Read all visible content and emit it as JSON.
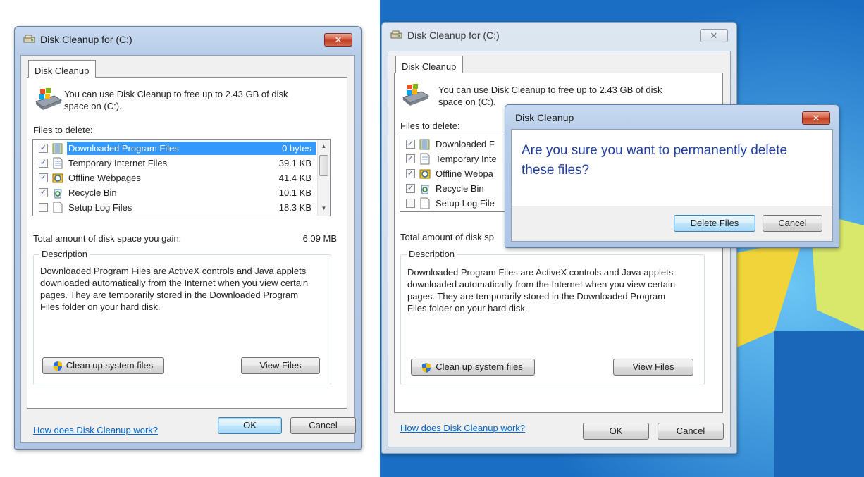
{
  "windows": [
    {
      "title": "Disk Cleanup for  (C:)",
      "tab": "Disk Cleanup",
      "intro": "You can use Disk Cleanup to free up to 2.43 GB of disk space on  (C:).",
      "intro_line1": "You can use Disk Cleanup to free up to 2.43 GB of disk",
      "intro_line2": "space on  (C:).",
      "files_label": "Files to delete:",
      "files": [
        {
          "label": "Downloaded Program Files",
          "size": "0 bytes",
          "checked": true,
          "selected": true,
          "icon": "folder-icon"
        },
        {
          "label": "Temporary Internet Files",
          "size": "39.1 KB",
          "checked": true,
          "selected": false,
          "icon": "document-icon"
        },
        {
          "label": "Offline Webpages",
          "size": "41.4 KB",
          "checked": true,
          "selected": false,
          "icon": "offline-sync-icon"
        },
        {
          "label": "Recycle Bin",
          "size": "10.1 KB",
          "checked": true,
          "selected": false,
          "icon": "recycle-bin-icon"
        },
        {
          "label": "Setup Log Files",
          "size": "18.3 KB",
          "checked": false,
          "selected": false,
          "icon": "document-icon"
        }
      ],
      "total_label": "Total amount of disk space you gain:",
      "total_value": "6.09 MB",
      "description_title": "Description",
      "description_lines": [
        "Downloaded Program Files are ActiveX controls and Java applets",
        "downloaded automatically from the Internet when you view certain",
        "pages. They are temporarily stored in the Downloaded Program",
        "Files folder on your hard disk."
      ],
      "cleanup_button": "Clean up system files",
      "view_button": "View Files",
      "help_link": "How does Disk Cleanup work?",
      "ok_button": "OK",
      "cancel_button": "Cancel",
      "close_glyph": "✕"
    },
    {
      "title": "Disk Cleanup for  (C:)",
      "tab": "Disk Cleanup",
      "intro_line1": "You can use Disk Cleanup to free up to 2.43 GB of disk",
      "intro_line2": "space on  (C:).",
      "files_label": "Files to delete:",
      "files": [
        {
          "label": "Downloaded F",
          "checked": true,
          "icon": "folder-icon"
        },
        {
          "label": "Temporary Inte",
          "checked": true,
          "icon": "document-icon"
        },
        {
          "label": "Offline Webpa",
          "checked": true,
          "icon": "offline-sync-icon"
        },
        {
          "label": "Recycle Bin",
          "checked": true,
          "icon": "recycle-bin-icon"
        },
        {
          "label": "Setup Log File",
          "checked": false,
          "icon": "document-icon"
        }
      ],
      "total_label": "Total amount of disk sp",
      "description_title": "Description",
      "description_lines": [
        "Downloaded Program Files are ActiveX controls and Java applets",
        "downloaded automatically from the Internet when you view certain",
        "pages. They are temporarily stored in the Downloaded Program",
        "Files folder on your hard disk."
      ],
      "cleanup_button": "Clean up system files",
      "view_button": "View Files",
      "help_link": "How does Disk Cleanup work?",
      "ok_button": "OK",
      "cancel_button": "Cancel",
      "close_glyph": "✕"
    }
  ],
  "confirm": {
    "title": "Disk Cleanup",
    "message_line1": "Are you sure you want to permanently delete",
    "message_line2": "these files?",
    "delete_button": "Delete Files",
    "cancel_button": "Cancel",
    "close_glyph": "✕"
  },
  "checkmark": "✓",
  "colors": {
    "selection": "#3399ff",
    "link": "#0066cc",
    "message": "#1f3d9e",
    "desktop": "#1f7fd0"
  }
}
